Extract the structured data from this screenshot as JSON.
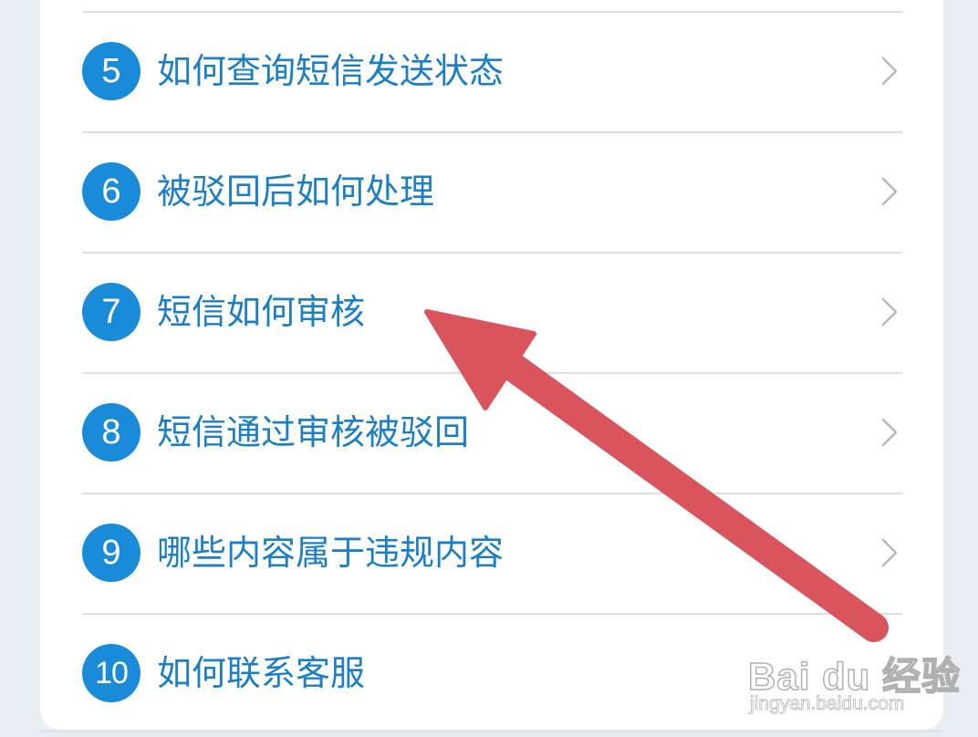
{
  "faq": {
    "items": [
      {
        "number": "5",
        "label": "如何查询短信发送状态"
      },
      {
        "number": "6",
        "label": "被驳回后如何处理"
      },
      {
        "number": "7",
        "label": "短信如何审核"
      },
      {
        "number": "8",
        "label": "短信通过审核被驳回"
      },
      {
        "number": "9",
        "label": "哪些内容属于违规内容"
      },
      {
        "number": "10",
        "label": "如何联系客服"
      }
    ],
    "chevron_icon": "chevron-right-icon"
  },
  "annotation": {
    "arrow_color": "#d9545c",
    "arrow_icon": "arrow-pointer-icon"
  },
  "watermark": {
    "logo": "Bai du 经验",
    "url": "jingyan.baidu.com"
  },
  "colors": {
    "accent": "#1a8bd8",
    "label": "#1c7fc4",
    "divider": "#dcdfe2"
  }
}
